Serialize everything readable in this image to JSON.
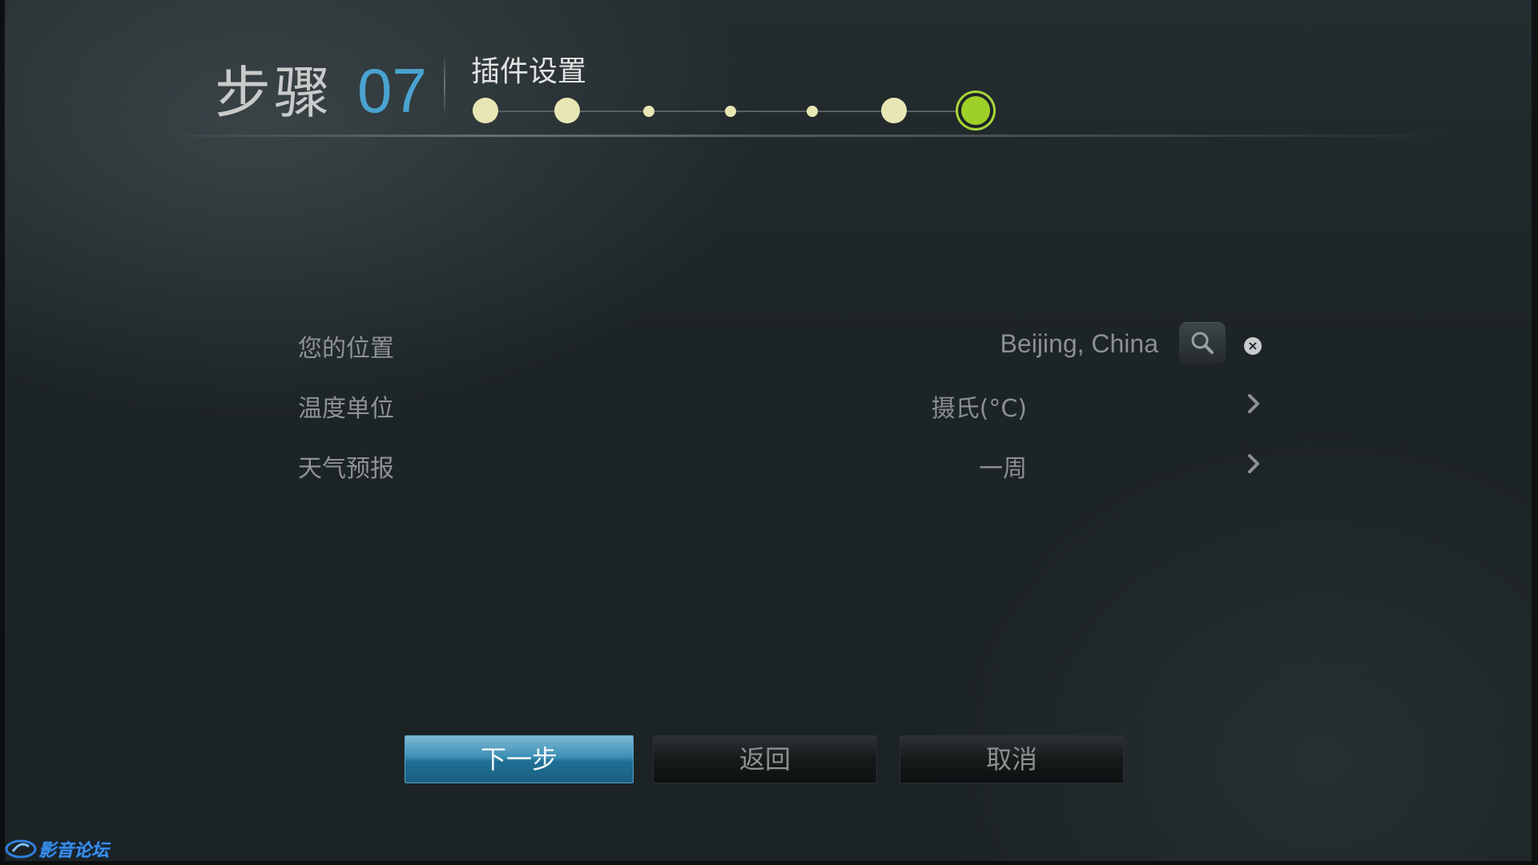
{
  "header": {
    "step_word": "步骤",
    "step_number": "07",
    "section_title": "插件设置",
    "progress": {
      "total_steps": 7,
      "current_step": 7,
      "accent_color": "#9ed128",
      "dot_color": "#e8e6b4"
    }
  },
  "settings": [
    {
      "label": "您的位置",
      "value": "Beijing, China",
      "controls": [
        "search-icon",
        "clear-icon"
      ]
    },
    {
      "label": "温度单位",
      "value": "摄氏(°C)",
      "controls": [
        "chevron-right-icon"
      ]
    },
    {
      "label": "天气预报",
      "value": "一周",
      "controls": [
        "chevron-right-icon"
      ]
    }
  ],
  "buttons": {
    "next": "下一步",
    "back": "返回",
    "cancel": "取消",
    "primary_color": "#2a7fa8"
  },
  "watermark": {
    "text": "影音论坛",
    "logo": "swirl-logo-icon"
  }
}
